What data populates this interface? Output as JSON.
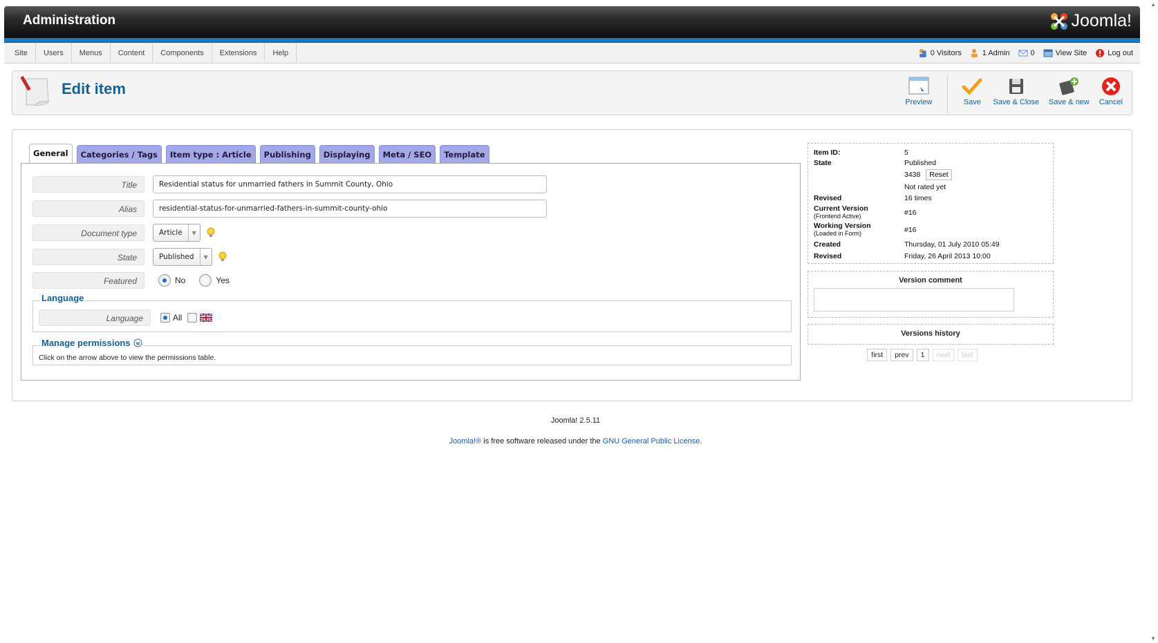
{
  "header": {
    "title": "Administration",
    "logo_text": "Joomla!"
  },
  "menu": [
    "Site",
    "Users",
    "Menus",
    "Content",
    "Components",
    "Extensions",
    "Help"
  ],
  "status": {
    "visitors": "0 Visitors",
    "admins": "1 Admin",
    "messages": "0",
    "view_site": "View Site",
    "logout": "Log out"
  },
  "page": {
    "title": "Edit item"
  },
  "toolbar": {
    "preview": "Preview",
    "save": "Save",
    "save_close": "Save & Close",
    "save_new": "Save & new",
    "cancel": "Cancel"
  },
  "tabs": [
    "General",
    "Categories / Tags",
    "Item type : Article",
    "Publishing",
    "Displaying",
    "Meta / SEO",
    "Template"
  ],
  "form": {
    "title_label": "Title",
    "title_value": "Residential status for unmarried fathers in Summit County, Ohio",
    "alias_label": "Alias",
    "alias_value": "residential-status-for-unmarried-fathers-in-summit-county-ohio",
    "doctype_label": "Document type",
    "doctype_value": "Article",
    "state_label": "State",
    "state_value": "Published",
    "featured_label": "Featured",
    "featured_no": "No",
    "featured_yes": "Yes",
    "language_legend": "Language",
    "language_label": "Language",
    "language_all": "All",
    "permissions_legend": "Manage permissions",
    "permissions_text": "Click on the arrow above to view the permissions table."
  },
  "info": {
    "item_id_label": "Item ID:",
    "item_id": "5",
    "state_label": "State",
    "state": "Published",
    "hits": "3438",
    "reset": "Reset",
    "rating": "Not rated yet",
    "revised_label": "Revised",
    "revised": "16 times",
    "current_version_label": "Current Version",
    "current_version_sub": "(Frontend Active)",
    "current_version": "#16",
    "working_version_label": "Working Version",
    "working_version_sub": "(Loaded in Form)",
    "working_version": "#16",
    "created_label": "Created",
    "created": "Thursday, 01 July 2010 05:49",
    "revised_date_label": "Revised",
    "revised_date": "Friday, 26 April 2013 10:00"
  },
  "version_comment": {
    "title": "Version comment"
  },
  "versions_history": {
    "title": "Versions history"
  },
  "pager": {
    "first": "first",
    "prev": "prev",
    "page": "1",
    "next": "next",
    "last": "last"
  },
  "footer": {
    "version": "Joomla! 2.5.11",
    "joomla_link": "Joomla!®",
    "license_text": " is free software released under the ",
    "license_link": "GNU General Public License",
    "period": "."
  },
  "colors": {
    "accent_blue": "#1a79bd",
    "tab_purple": "#a5a8e8",
    "title_blue": "#146295"
  }
}
